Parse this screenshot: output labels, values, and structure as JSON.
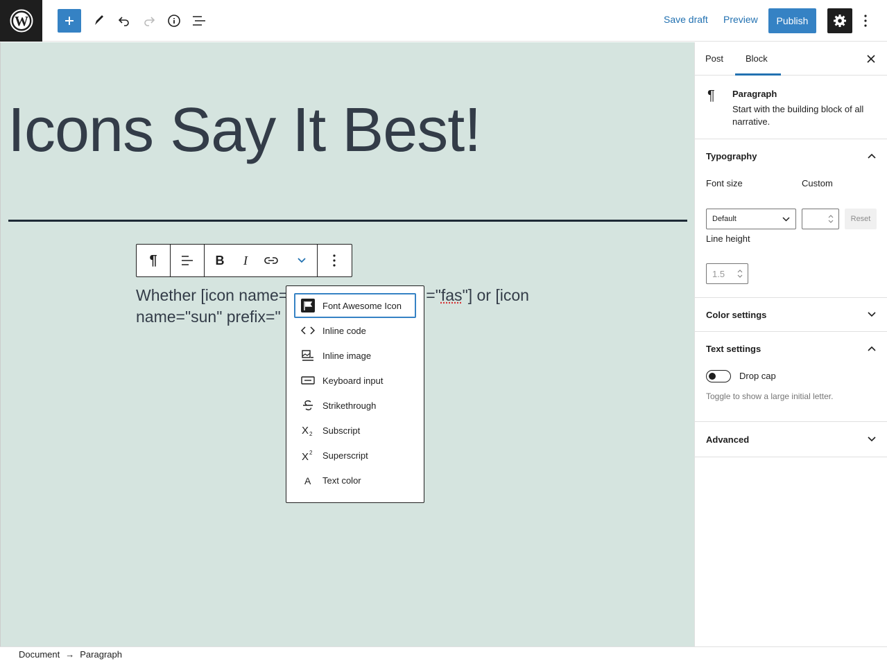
{
  "topbar": {
    "save_draft": "Save draft",
    "preview": "Preview",
    "publish": "Publish"
  },
  "editor": {
    "title": "Icons Say It Best!",
    "paragraph_line1_a": "Whether [icon name=",
    "paragraph_line1_b": "=\"",
    "paragraph_line1_spell": "fas",
    "paragraph_line1_c": "\"] or [icon",
    "paragraph_line2": "name=\"sun\" prefix=\""
  },
  "format_menu": {
    "items": [
      {
        "label": "Font Awesome Icon",
        "icon": "flag-icon"
      },
      {
        "label": "Inline code",
        "icon": "code-icon"
      },
      {
        "label": "Inline image",
        "icon": "image-icon"
      },
      {
        "label": "Keyboard input",
        "icon": "keyboard-icon"
      },
      {
        "label": "Strikethrough",
        "icon": "strikethrough-icon"
      },
      {
        "label": "Subscript",
        "icon": "subscript-icon"
      },
      {
        "label": "Superscript",
        "icon": "superscript-icon"
      },
      {
        "label": "Text color",
        "icon": "text-color-icon"
      }
    ]
  },
  "sidebar": {
    "tab_post": "Post",
    "tab_block": "Block",
    "block_name": "Paragraph",
    "block_desc": "Start with the building block of all narrative.",
    "typography": {
      "title": "Typography",
      "font_size_label": "Font size",
      "custom_label": "Custom",
      "font_size_value": "Default",
      "reset": "Reset",
      "line_height_label": "Line height",
      "line_height_placeholder": "1.5"
    },
    "color_settings": "Color settings",
    "text_settings": {
      "title": "Text settings",
      "drop_cap_label": "Drop cap",
      "drop_cap_help": "Toggle to show a large initial letter."
    },
    "advanced": "Advanced"
  },
  "breadcrumb": {
    "root": "Document",
    "current": "Paragraph"
  },
  "colors": {
    "accent": "#3582c4",
    "canvas_bg": "#d5e4df",
    "dark": "#1e1e1e"
  }
}
